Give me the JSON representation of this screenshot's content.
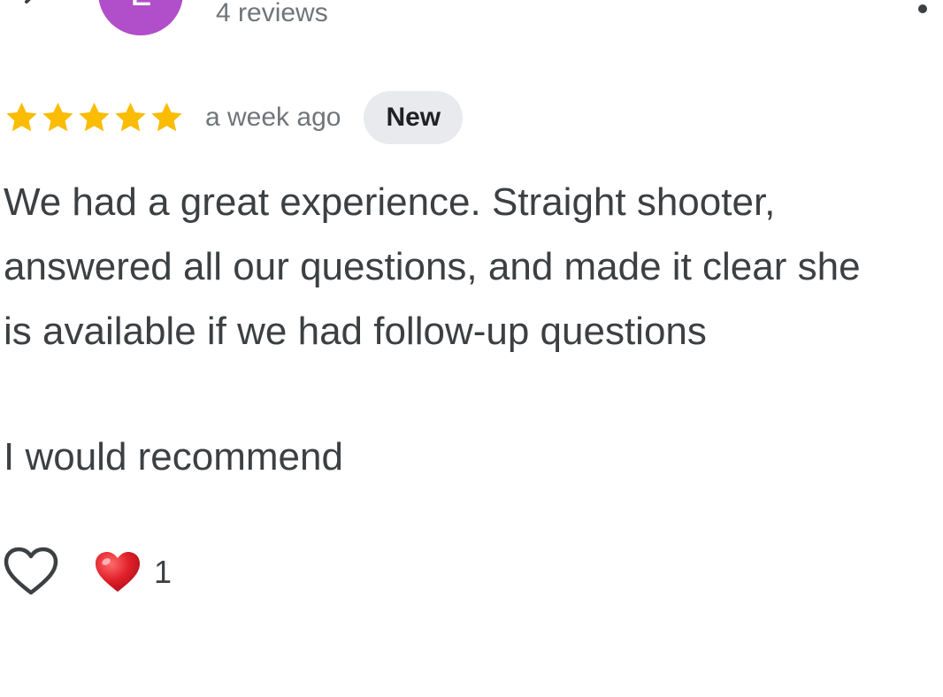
{
  "header": {
    "back_icon": "chevron-left-icon",
    "avatar_initial": "L",
    "avatar_color": "#b04fc9",
    "review_count": "4 reviews",
    "more_icon": "more-vert-icon"
  },
  "review": {
    "rating": 5,
    "rating_max": 5,
    "star_color": "#fbbc04",
    "time_ago": "a week ago",
    "badge": "New",
    "body_paragraph_1": "We had a great experience. Straight shooter,\nanswered all our questions, and made it clear she\nis available if we had follow-up questions",
    "body_paragraph_2": "I would recommend"
  },
  "reactions": {
    "react_icon": "heart-outline-icon",
    "heart_icon": "red-heart-emoji",
    "heart_color": "#e0202a",
    "heart_count": "1"
  }
}
